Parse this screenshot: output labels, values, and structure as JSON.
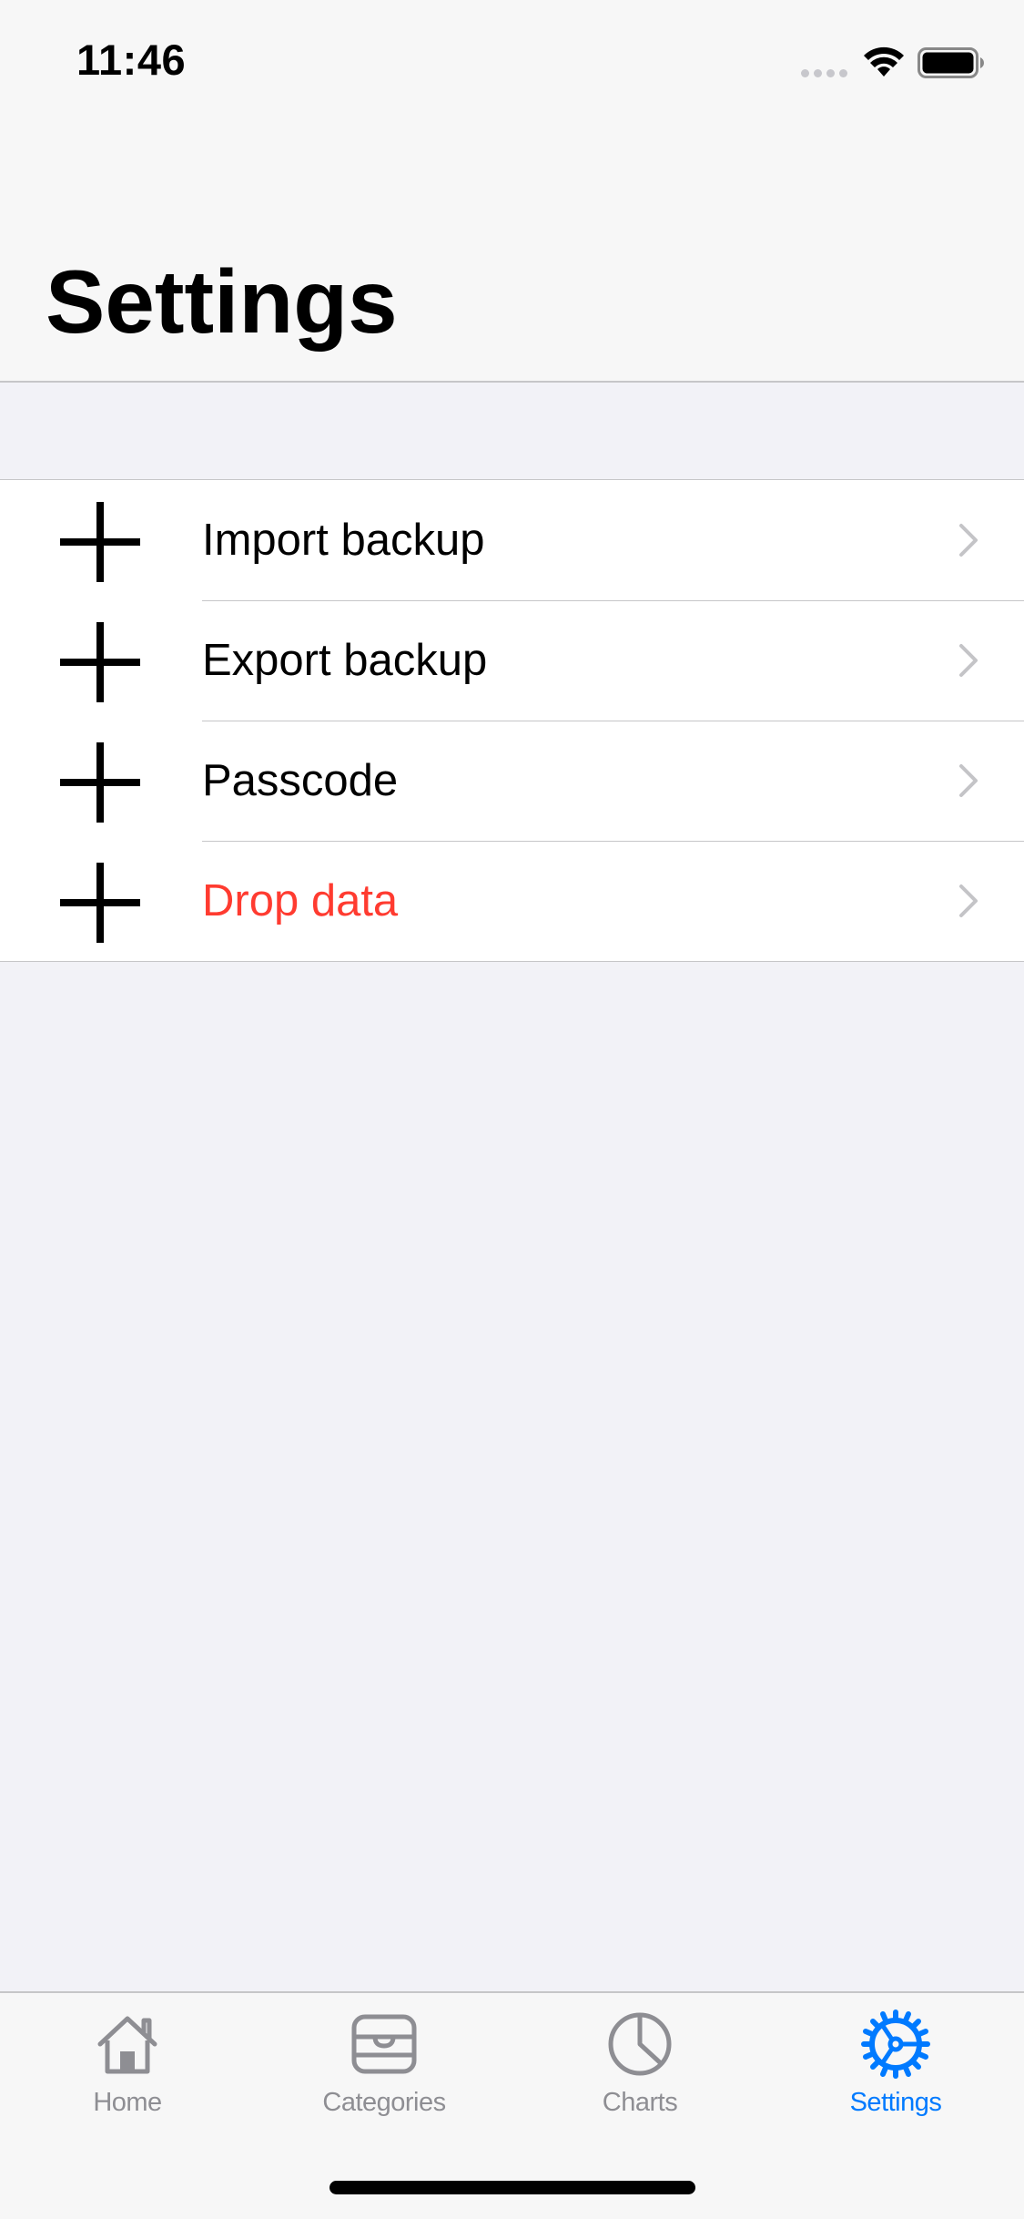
{
  "status_bar": {
    "time": "11:46"
  },
  "header": {
    "title": "Settings"
  },
  "settings": {
    "items": [
      {
        "label": "Import backup",
        "icon": "plus-icon",
        "style": "default"
      },
      {
        "label": "Export backup",
        "icon": "plus-icon",
        "style": "default"
      },
      {
        "label": "Passcode",
        "icon": "plus-icon",
        "style": "default"
      },
      {
        "label": "Drop data",
        "icon": "plus-icon",
        "style": "destructive"
      }
    ]
  },
  "tab_bar": {
    "tabs": [
      {
        "label": "Home",
        "icon": "home-icon",
        "active": false
      },
      {
        "label": "Categories",
        "icon": "tray-icon",
        "active": false
      },
      {
        "label": "Charts",
        "icon": "pie-chart-icon",
        "active": false
      },
      {
        "label": "Settings",
        "icon": "gear-icon",
        "active": true
      }
    ]
  },
  "colors": {
    "accent": "#007AFF",
    "destructive": "#FF3B30",
    "inactive_tab": "#8E8E93",
    "background": "#F2F2F7"
  }
}
